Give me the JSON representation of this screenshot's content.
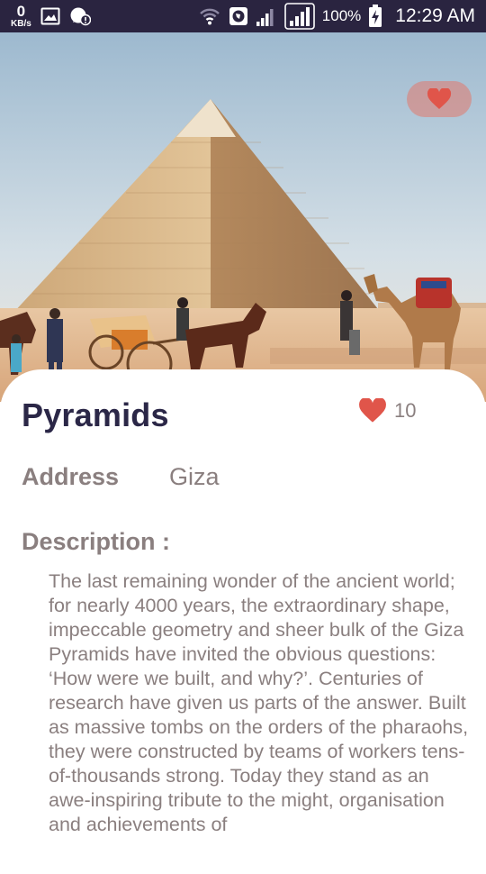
{
  "status_bar": {
    "speed_value": "0",
    "speed_unit": "KB/s",
    "battery": "100%",
    "time": "12:29 AM",
    "icons": [
      "gallery-icon",
      "whatsapp-icon",
      "wifi-icon",
      "browser-icon",
      "signal-icon",
      "signal-icon",
      "battery-charging-icon"
    ]
  },
  "hero": {
    "image": "pyramid-photo",
    "favorite_icon": "heart-icon",
    "favorite_color": "#e2786c"
  },
  "place": {
    "title": "Pyramids",
    "likes_icon": "heart-icon",
    "likes_count": "10",
    "address_label": "Address",
    "address_value": "Giza",
    "description_label": "Description :",
    "description": "The last remaining wonder of the ancient world; for nearly 4000 years, the extraordinary shape, impeccable geometry and sheer bulk of the Giza Pyramids have invited the obvious questions: ‘How were we built, and why?’. Centuries of research have given us parts of the answer. Built as massive tombs on the orders of the pharaohs, they were constructed by teams of workers tens-of-thousands strong. Today they stand as an awe-inspiring tribute to the might, organisation and achievements of"
  },
  "colors": {
    "status_bar": "#2a2440",
    "title": "#2b2747",
    "text": "#8a7f7f",
    "heart": "#e0554a"
  }
}
